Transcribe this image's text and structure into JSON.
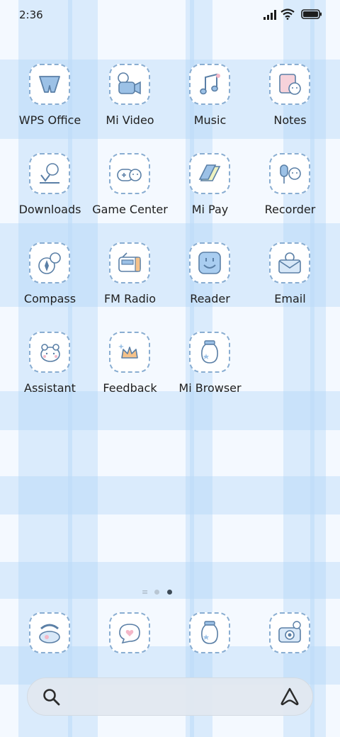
{
  "status_bar": {
    "time": "2:36",
    "icons": [
      "signal-icon",
      "wifi-icon",
      "battery-icon"
    ]
  },
  "apps": [
    {
      "label": "WPS Office",
      "icon": "wps-office-icon"
    },
    {
      "label": "Mi Video",
      "icon": "mi-video-icon"
    },
    {
      "label": "Music",
      "icon": "music-icon"
    },
    {
      "label": "Notes",
      "icon": "notes-icon"
    },
    {
      "label": "Downloads",
      "icon": "downloads-icon"
    },
    {
      "label": "Game Center",
      "icon": "game-center-icon"
    },
    {
      "label": "Mi Pay",
      "icon": "mi-pay-icon"
    },
    {
      "label": "Recorder",
      "icon": "recorder-icon"
    },
    {
      "label": "Compass",
      "icon": "compass-icon"
    },
    {
      "label": "FM Radio",
      "icon": "fm-radio-icon"
    },
    {
      "label": "Reader",
      "icon": "reader-icon"
    },
    {
      "label": "Email",
      "icon": "email-icon"
    },
    {
      "label": "Assistant",
      "icon": "assistant-icon"
    },
    {
      "label": "Feedback",
      "icon": "feedback-icon"
    },
    {
      "label": "Mi Browser",
      "icon": "mi-browser-icon"
    }
  ],
  "page_indicator": {
    "pages": 2,
    "current": 2
  },
  "dock": [
    {
      "icon": "phone-icon"
    },
    {
      "icon": "messages-icon"
    },
    {
      "icon": "browser-icon"
    },
    {
      "icon": "camera-icon"
    }
  ],
  "search_bar": {
    "search_icon": "search-icon",
    "assistant_icon": "assistant-logo-icon"
  },
  "colors": {
    "icon_outline": "#8aaed2",
    "icon_fill": "#ffffff",
    "accent_blue": "#a9cdf0",
    "text": "#202020"
  }
}
